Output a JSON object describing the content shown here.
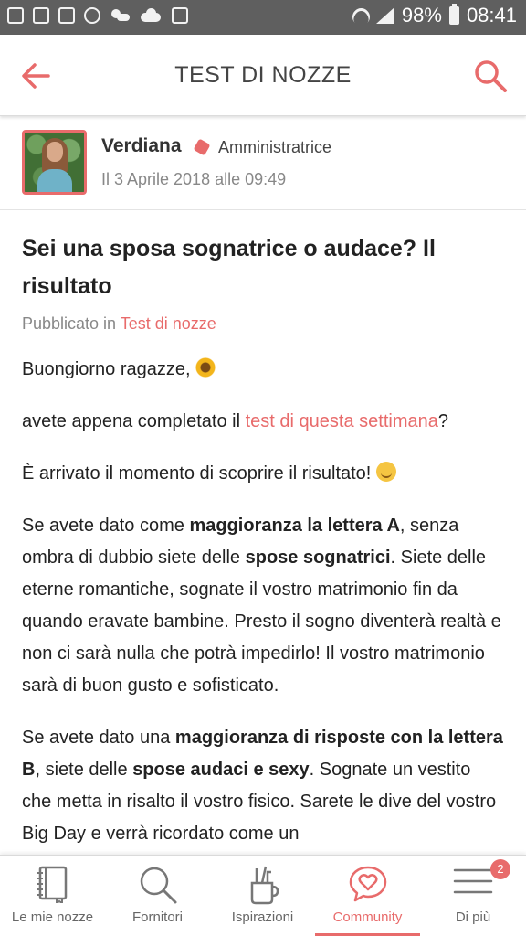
{
  "statusbar": {
    "battery": "98%",
    "time": "08:41",
    "icons": [
      "image-icon",
      "recycle-icon",
      "facebook-icon",
      "dollar-icon",
      "weather-icon",
      "cloud-icon",
      "calendar-icon",
      "wifi-icon",
      "signal-icon",
      "battery-icon"
    ]
  },
  "appbar": {
    "title": "TEST DI NOZZE",
    "back_icon": "arrow-left-icon",
    "search_icon": "search-icon",
    "accent": "#e86b6b"
  },
  "author": {
    "name": "Verdiana",
    "role": "Amministratrice",
    "date": "Il 3 Aprile 2018 alle 09:49"
  },
  "post": {
    "title": "Sei una sposa sognatrice o audace? Il risultato",
    "published_prefix": "Pubblicato in",
    "published_category": "Test di nozze",
    "p1_text": "Buongiorno ragazze,",
    "p2_pre": "avete appena completato il",
    "p2_link": "test di questa settimana",
    "p2_post": "?",
    "p3_text": "È arrivato il momento di scoprire il risultato!",
    "p4": {
      "t1": "Se avete dato come",
      "b1": "maggioranza la lettera A",
      "t2": ", senza ombra di dubbio siete delle",
      "b2": "spose sognatrici",
      "t3": ". Siete delle eterne romantiche, sognate il vostro matrimonio fin da quando eravate bambine. Presto il sogno diventerà realtà e non ci sarà nulla che potrà impedirlo! Il vostro matrimonio sarà di buon gusto e sofisticato."
    },
    "p5": {
      "t1": "Se avete dato una",
      "b1": "maggioranza di risposte con la lettera B",
      "t2": ", siete delle",
      "b2": "spose audaci e sexy",
      "t3": ". Sognate un vestito che metta in risalto il vostro fisico. Sarete le dive del vostro Big Day e verrà ricordato come un"
    }
  },
  "bottomnav": {
    "items": [
      {
        "label": "Le mie nozze",
        "icon": "notebook-icon"
      },
      {
        "label": "Fornitori",
        "icon": "search-icon"
      },
      {
        "label": "Ispirazioni",
        "icon": "tools-cup-icon"
      },
      {
        "label": "Community",
        "icon": "heart-chat-icon",
        "active": true
      },
      {
        "label": "Di più",
        "icon": "menu-icon",
        "badge": "2"
      }
    ]
  }
}
